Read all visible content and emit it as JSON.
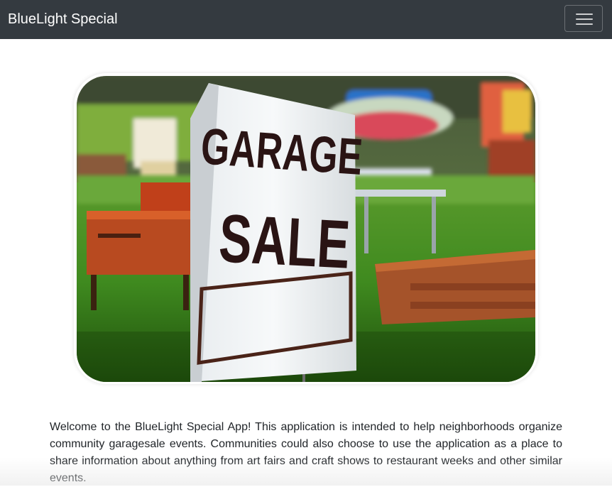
{
  "navbar": {
    "brand": "BlueLight Special",
    "toggler_icon": "hamburger-menu-icon"
  },
  "hero": {
    "sign_line1": "GARAGE",
    "sign_line2": "SALE"
  },
  "intro": {
    "text": "Welcome to the BlueLight Special App! This application is intended to help neighborhoods organize community garagesale events. Communities could also choose to use the application as a place to share information about anything from art fairs and craft shows to restaurant weeks and other similar events."
  },
  "colors": {
    "navbar_bg": "#343a40",
    "brand_text": "#ffffff",
    "body_text": "#212529"
  }
}
